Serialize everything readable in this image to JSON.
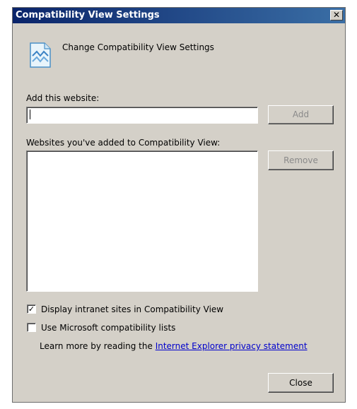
{
  "window": {
    "title": "Compatibility View Settings",
    "close_glyph": "✕"
  },
  "header": {
    "text": "Change Compatibility View Settings",
    "icon": "compatibility-view-icon"
  },
  "add_website": {
    "label": "Add this website:",
    "value": "",
    "add_button": "Add"
  },
  "website_list": {
    "label": "Websites you've added to Compatibility View:",
    "items": [],
    "remove_button": "Remove"
  },
  "options": {
    "intranet": {
      "label": "Display intranet sites in Compatibility View",
      "checked": true,
      "mark": "✓"
    },
    "ms_lists": {
      "label": "Use Microsoft compatibility lists",
      "checked": false
    }
  },
  "learn_more": {
    "prefix": "Learn more by reading the ",
    "link": "Internet Explorer privacy statement"
  },
  "footer": {
    "close_button": "Close"
  }
}
